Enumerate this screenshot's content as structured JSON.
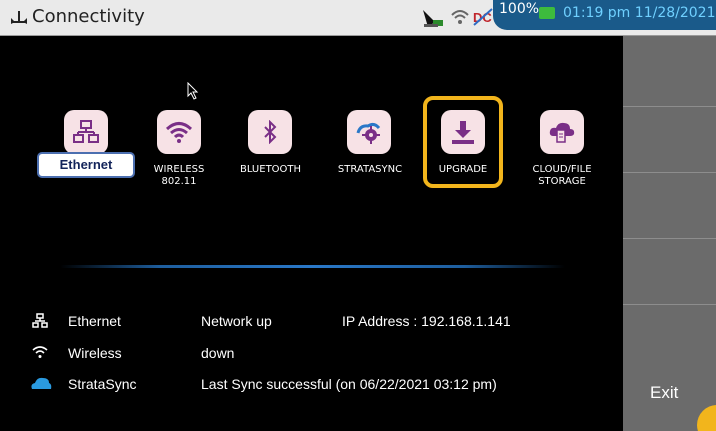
{
  "app": {
    "title": "Connectivity"
  },
  "status": {
    "battery_percent": "100%",
    "battery_level": 1.0,
    "time": "01:19 pm",
    "date": "11/28/2021",
    "icons": [
      "satellite-dish-icon",
      "wifi-icon",
      "dc-power-icon",
      "battery-icon"
    ]
  },
  "tiles": [
    {
      "label": "Ethernet",
      "icon": "network-icon",
      "selected": true
    },
    {
      "label": "WIRELESS\n802.11",
      "icon": "wifi-icon"
    },
    {
      "label": "BLUETOOTH",
      "icon": "bluetooth-icon"
    },
    {
      "label": "STRATASYNC",
      "icon": "stratasync-cloud-gear-icon"
    },
    {
      "label": "UPGRADE",
      "icon": "download-icon",
      "highlighted": true
    },
    {
      "label": "CLOUD/FILE\nSTORAGE",
      "icon": "cloud-file-icon"
    }
  ],
  "connections": [
    {
      "name": "Ethernet",
      "icon": "network-icon",
      "state": "Network up",
      "ip": "IP Address : 192.168.1.141"
    },
    {
      "name": "Wireless",
      "icon": "wifi-icon",
      "state": "down"
    },
    {
      "name": "StrataSync",
      "icon": "cloud-icon",
      "state": "Last Sync successful (on 06/22/2021 03:12 pm)"
    }
  ],
  "side_panel": {
    "exit_label": "Exit"
  },
  "colors": {
    "accent_highlight": "#f2b51c",
    "tile_bg": "#f7e2e6",
    "icon_purple": "#7a2f87",
    "status_panel": "#1a5a8a",
    "clock_text": "#6fd0ff"
  }
}
